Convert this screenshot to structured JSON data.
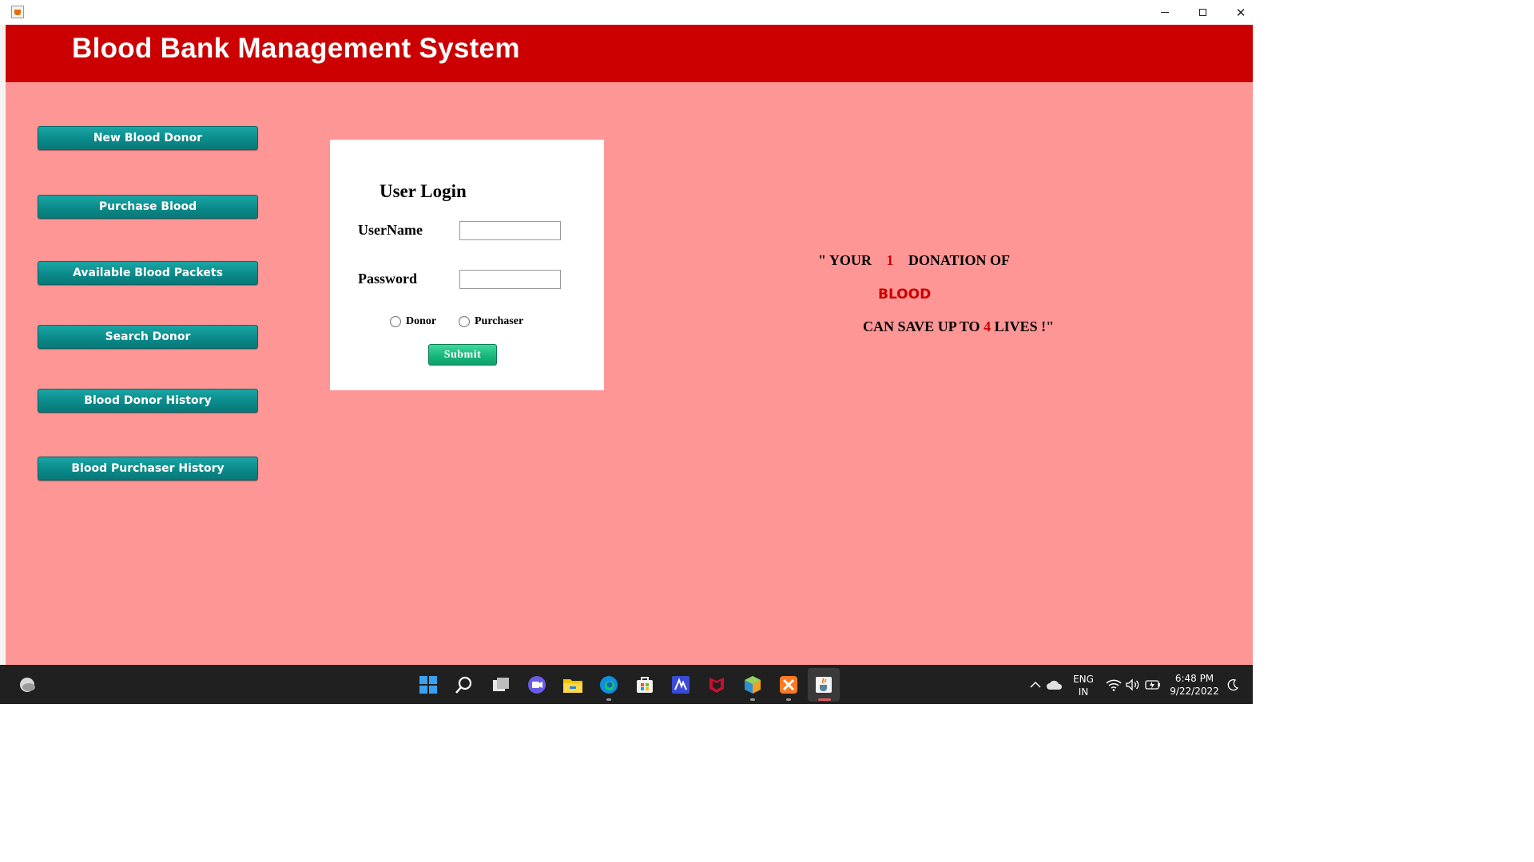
{
  "window": {
    "minimize_glyph": "",
    "close_glyph": "✕"
  },
  "header": {
    "title": "Blood Bank Management System"
  },
  "nav": {
    "items": [
      {
        "label": "New Blood Donor"
      },
      {
        "label": "Purchase Blood"
      },
      {
        "label": "Available Blood Packets"
      },
      {
        "label": "Search  Donor"
      },
      {
        "label": "Blood Donor History"
      },
      {
        "label": "Blood Purchaser History"
      }
    ]
  },
  "login": {
    "title": "User Login",
    "username_label": "UserName",
    "username_value": "",
    "password_label": "Password",
    "password_value": "",
    "radio_donor": "Donor",
    "radio_purchaser": "Purchaser",
    "submit_label": "Submit"
  },
  "quote": {
    "line1_prefix": "\" YOUR",
    "line1_number": "1",
    "line1_suffix": "DONATION OF",
    "line2": "BLOOD",
    "line3_prefix": "CAN SAVE UP TO",
    "line3_number": "4",
    "line3_suffix": "LIVES !\""
  },
  "taskbar": {
    "icons": [
      "weather-icon",
      "start-icon",
      "search-icon",
      "task-view-icon",
      "chat-icon",
      "file-explorer-icon",
      "edge-icon",
      "store-icon",
      "app-icon",
      "mcafee-icon",
      "netbeans-icon",
      "xampp-icon",
      "java-icon"
    ],
    "language_line1": "ENG",
    "language_line2": "IN",
    "time": "6:48 PM",
    "date": "9/22/2022"
  },
  "colors": {
    "header": "#cc0000",
    "background": "#ff9696",
    "nav_button": "#0b8a8a",
    "submit_button": "#16b47a",
    "accent_red": "#cc0000"
  }
}
